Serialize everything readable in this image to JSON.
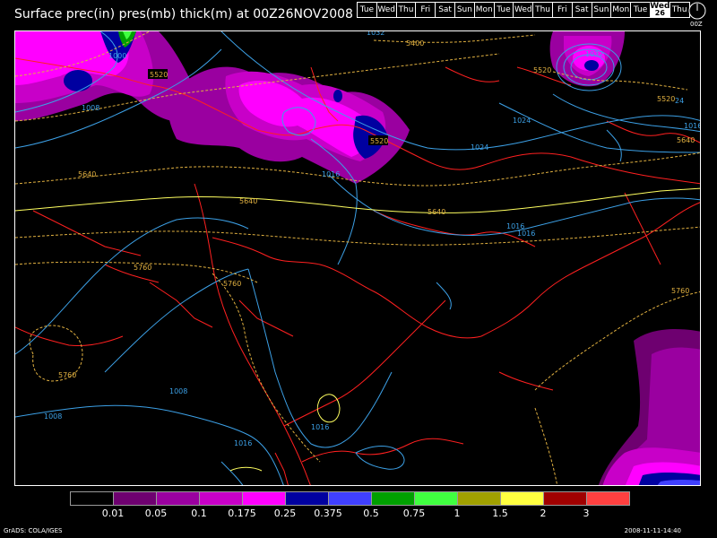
{
  "title": "Surface prec(in) pres(mb) thick(m) at 00Z26NOV2008",
  "day_strip": {
    "days": [
      {
        "label": "Tue",
        "num": ""
      },
      {
        "label": "Wed",
        "num": ""
      },
      {
        "label": "Thu",
        "num": ""
      },
      {
        "label": "Fri",
        "num": ""
      },
      {
        "label": "Sat",
        "num": ""
      },
      {
        "label": "Sun",
        "num": ""
      },
      {
        "label": "Mon",
        "num": ""
      },
      {
        "label": "Tue",
        "num": ""
      },
      {
        "label": "Wed",
        "num": ""
      },
      {
        "label": "Thu",
        "num": ""
      },
      {
        "label": "Fri",
        "num": ""
      },
      {
        "label": "Sat",
        "num": ""
      },
      {
        "label": "Sun",
        "num": ""
      },
      {
        "label": "Mon",
        "num": ""
      },
      {
        "label": "Tue",
        "num": ""
      },
      {
        "label": "Wed",
        "num": "26"
      },
      {
        "label": "Thu",
        "num": ""
      }
    ],
    "active_index": 15
  },
  "clock_label": "00Z",
  "colorbar": {
    "colors": [
      "#000000",
      "#6e0070",
      "#9a00a0",
      "#c800c8",
      "#ff00ff",
      "#0000a0",
      "#4040ff",
      "#00a000",
      "#40ff40",
      "#a0a000",
      "#ffff40",
      "#a00000",
      "#ff4040"
    ],
    "labels": [
      "0.01",
      "0.05",
      "0.1",
      "0.175",
      "0.25",
      "0.375",
      "0.5",
      "0.75",
      "1",
      "1.5",
      "2",
      "3"
    ]
  },
  "contour_labels": {
    "pressure": [
      "1032",
      "1000",
      "1008",
      "1024",
      "1024",
      "1016",
      "1016",
      "1016",
      "1008",
      "1008",
      "1016",
      "1016",
      "1032",
      "1016",
      "24"
    ],
    "thickness": [
      "5400",
      "5520",
      "5520",
      "5520",
      "5520",
      "5640",
      "5640",
      "5640",
      "5640",
      "5760",
      "5760",
      "5760",
      "5760"
    ]
  },
  "footer_left": "GrADS: COLA/IGES",
  "footer_right": "2008-11-11-14:40",
  "colors": {
    "pressure": "#3ca0e6",
    "thickness": "#e0b040",
    "coast": "#ff2020",
    "thickness_5640": "#ffff60"
  }
}
